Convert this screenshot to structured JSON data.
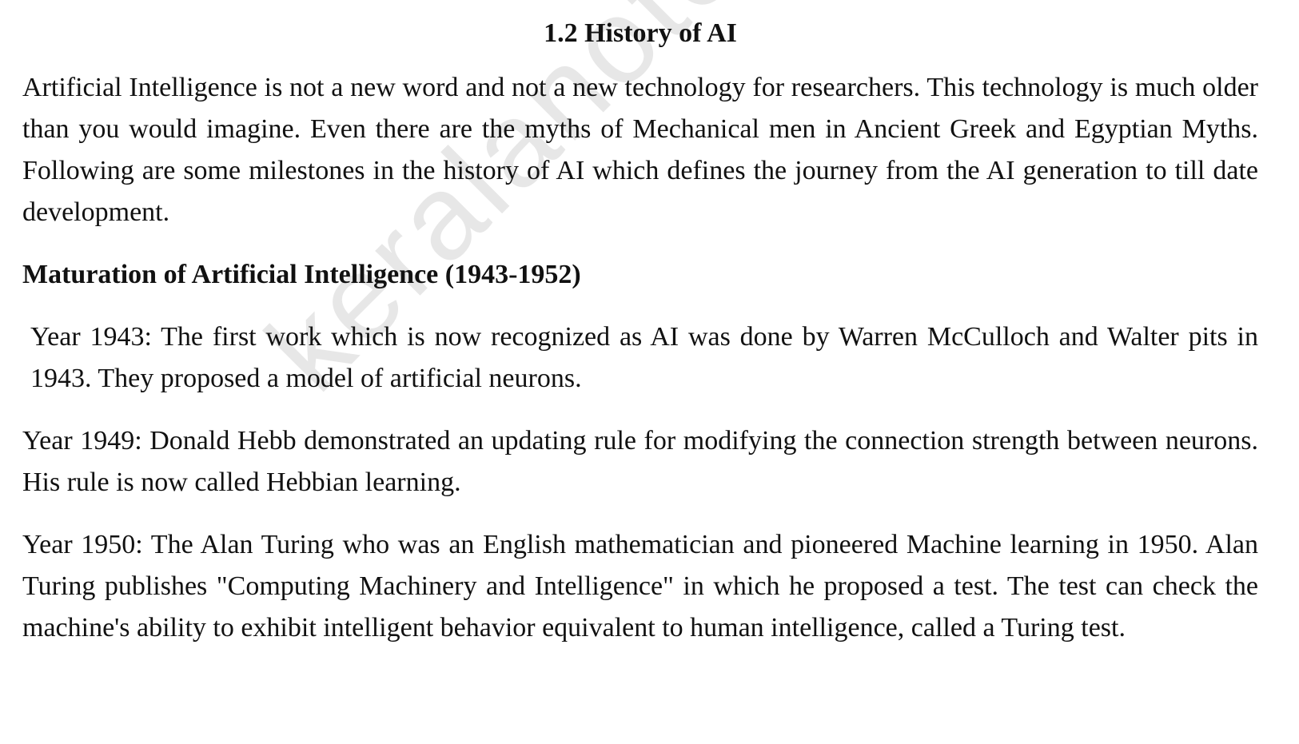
{
  "document": {
    "title": "1.2 History of AI",
    "intro": "Artificial Intelligence is not a new word and not a new technology for researchers. This technology is much older than you would imagine. Even there are the myths of Mechanical men in Ancient Greek and Egyptian Myths. Following are some milestones in the history of AI which defines the journey from the AI generation to till date development.",
    "section_heading": "Maturation of Artificial Intelligence (1943-1952)",
    "milestones": [
      "Year 1943: The first work which is now recognized as AI was done by Warren McCulloch and Walter pits in 1943. They proposed a model of artificial neurons.",
      "Year 1949: Donald Hebb demonstrated an updating rule for modifying the connection strength between neurons. His rule is now called Hebbian learning.",
      "Year 1950: The Alan Turing who was an English mathematician and pioneered Machine learning in 1950. Alan Turing publishes \"Computing Machinery and Intelligence\" in which he proposed a test. The test can check the machine's ability to exhibit intelligent behavior equivalent to human intelligence, called a Turing test."
    ]
  },
  "watermark": {
    "text": "keralanotes.com",
    "color": "#a0a0a0"
  }
}
